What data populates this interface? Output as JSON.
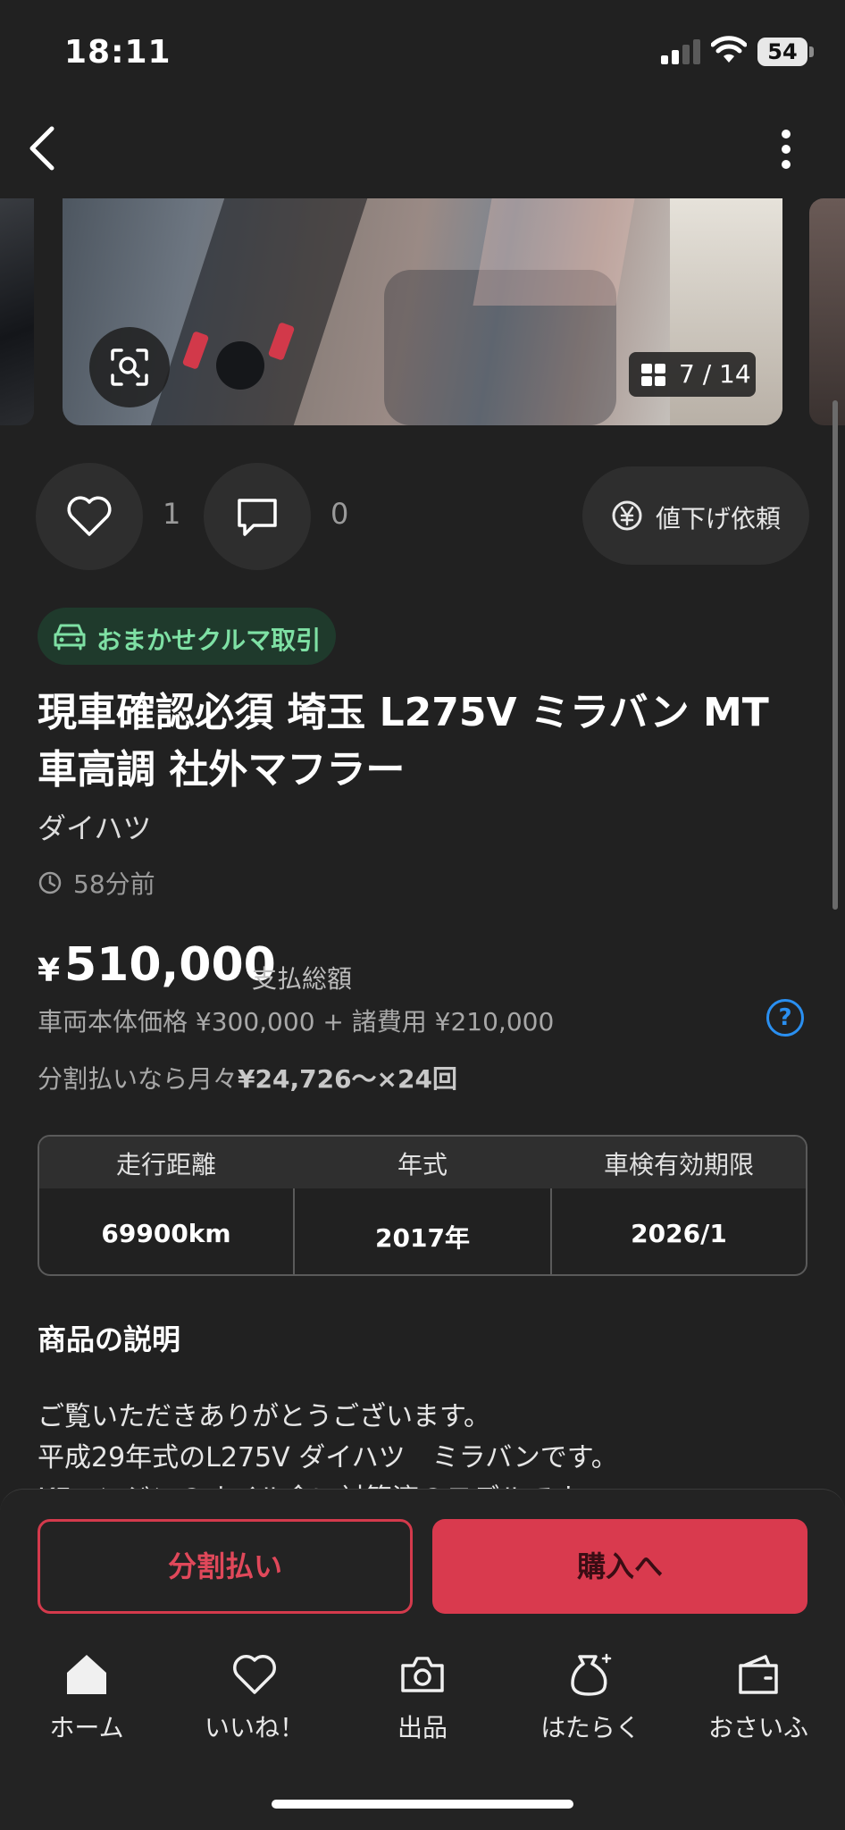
{
  "status_bar": {
    "time": "18:11",
    "battery": "54"
  },
  "gallery": {
    "counter": "7 / 14"
  },
  "actions": {
    "like_count": "1",
    "comment_count": "0",
    "price_down_label": "値下げ依頼"
  },
  "badge": {
    "label": "おまかせクルマ取引"
  },
  "item": {
    "title_line1": "現車確認必須 埼玉 L275V ミラバン MT",
    "title_line2": "車高調 社外マフラー",
    "maker": "ダイハツ",
    "posted": "58分前"
  },
  "price": {
    "currency": "¥",
    "value": "510,000",
    "label": "支払総額",
    "breakdown": "車両本体価格 ¥300,000 + 諸費用 ¥210,000",
    "installment_prefix": "分割払いなら月々",
    "installment_amount": "¥24,726〜×24回"
  },
  "specs": [
    {
      "label": "走行距離",
      "value": "69900km"
    },
    {
      "label": "年式",
      "value": "2017年"
    },
    {
      "label": "車検有効期限",
      "value": "2026/1"
    }
  ],
  "description": {
    "title": "商品の説明",
    "lines": [
      "ご覧いただきありがとうございます。",
      "平成29年式のL275V ダイハツ　ミラバンです。",
      "KFエンジンのオイル食い対策済のモデルです。"
    ]
  },
  "buttons": {
    "installment": "分割払い",
    "buy": "購入へ"
  },
  "tabs": [
    {
      "label": "ホーム",
      "icon": "home-icon"
    },
    {
      "label": "いいね！",
      "icon": "heart-icon"
    },
    {
      "label": "出品",
      "icon": "camera-icon"
    },
    {
      "label": "はたらく",
      "icon": "money-bag-icon"
    },
    {
      "label": "おさいふ",
      "icon": "wallet-icon"
    }
  ],
  "colors": {
    "background": "#212121",
    "accent_red": "#d93a4e",
    "badge_green": "#7ee0a4",
    "link_blue": "#2a8ff0"
  }
}
